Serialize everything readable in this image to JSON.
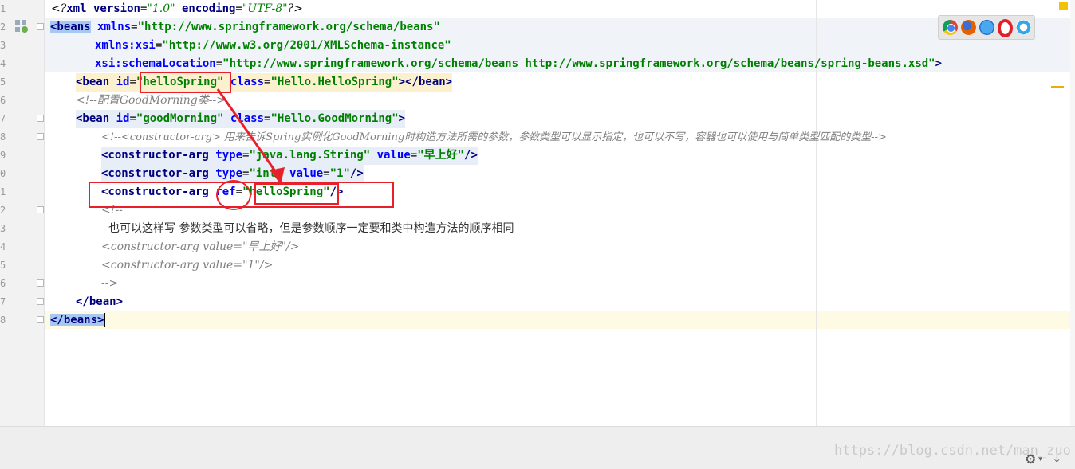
{
  "gutter": {
    "line_numbers": [
      "1",
      "2",
      "3",
      "4",
      "5",
      "6",
      "7",
      "8",
      "9",
      "0",
      "1",
      "2",
      "3",
      "4",
      "5",
      "6",
      "7",
      "8"
    ]
  },
  "code": {
    "l1": {
      "p1": "<?",
      "p2": "xml version",
      "p3": "=",
      "p4": "\"1.0\"",
      "p5": " encoding",
      "p6": "=",
      "p7": "\"UTF-8\"",
      "p8": "?>"
    },
    "l2": {
      "p1": "<beans",
      "p2": " xmlns",
      "p3": "=",
      "p4": "\"http://www.springframework.org/schema/beans\""
    },
    "l3": {
      "p1": "xmlns:xsi",
      "p2": "=",
      "p3": "\"http://www.w3.org/2001/XMLSchema-instance\""
    },
    "l4": {
      "p1": "xsi:schemaLocation",
      "p2": "=",
      "p3": "\"http://www.springframework.org/schema/beans http://www.springframework.org/schema/beans/spring-beans.xsd\"",
      "p4": ">"
    },
    "l5": {
      "p1": "<bean",
      "p2": " id",
      "p3": "=",
      "p4": "\"helloSpring\"",
      "p5": " class",
      "p6": "=",
      "p7": "\"Hello.HelloSpring\"",
      "p8": "></bean>"
    },
    "l6": {
      "p1": "<!--配置GoodMorning类-->"
    },
    "l7": {
      "p1": "<bean",
      "p2": " id",
      "p3": "=",
      "p4": "\"goodMorning\"",
      "p5": " class",
      "p6": "=",
      "p7": "\"Hello.GoodMorning\"",
      "p8": ">"
    },
    "l8": {
      "p1": "<!--<constructor-arg> 用来告诉Spring实例化GoodMorning时构造方法所需的参数，参数类型可以显示指定，也可以不写，容器也可以使用与简单类型匹配的类型-->"
    },
    "l9": {
      "p1": "<constructor-arg",
      "p2": " type",
      "p3": "=",
      "p4": "\"java.lang.String\"",
      "p5": " value",
      "p6": "=",
      "p7": "\"早上好\"",
      "p8": "/>"
    },
    "l10": {
      "p1": "<constructor-arg",
      "p2": " type",
      "p3": "=",
      "p4": "\"int\"",
      "p5": " value",
      "p6": "=",
      "p7": "\"1\"",
      "p8": "/>"
    },
    "l11": {
      "p1": "<constructor-arg",
      "p2": " ref",
      "p3": "=",
      "p4": "\"helloSpring\"",
      "p5": "/>"
    },
    "l12": {
      "p1": "<!--"
    },
    "l13": {
      "p1": "也可以这样写 参数类型可以省略，但是参数顺序一定要和类中构造方法的顺序相同"
    },
    "l14": {
      "p1": "<constructor-arg value=\"早上好\"/>"
    },
    "l15": {
      "p1": "<constructor-arg value=\"1\"/>"
    },
    "l16": {
      "p1": "-->"
    },
    "l17": {
      "p1": "</bean>"
    },
    "l18": {
      "p1": "</beans",
      "p2": ">"
    }
  },
  "browsers": [
    "chrome-icon",
    "firefox-icon",
    "safari-icon",
    "opera-icon",
    "ie-icon"
  ],
  "watermark": "https://blog.csdn.net/man_zuo",
  "colors": {
    "annotation": "#e8202a",
    "tag": "#000080",
    "attr": "#0000ff",
    "value": "#008000",
    "comment": "#808080"
  }
}
